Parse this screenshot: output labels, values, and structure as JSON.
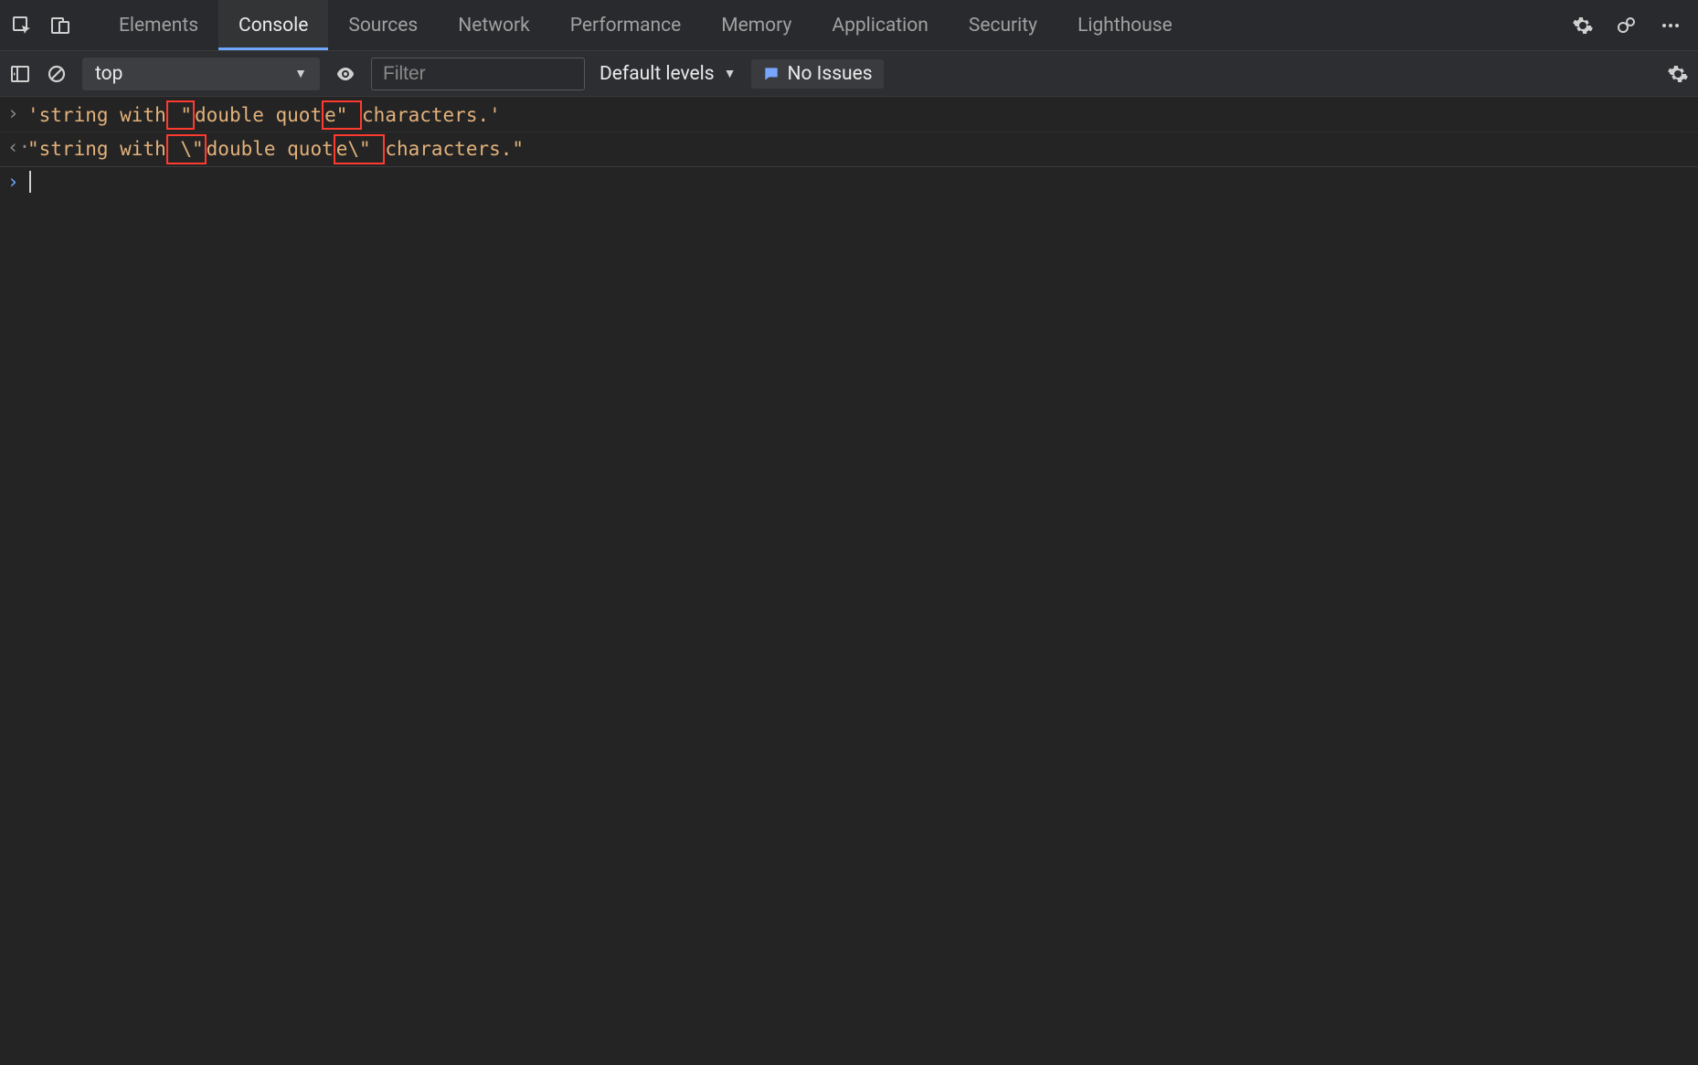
{
  "tabs": {
    "items": [
      {
        "label": "Elements",
        "active": false
      },
      {
        "label": "Console",
        "active": true
      },
      {
        "label": "Sources",
        "active": false
      },
      {
        "label": "Network",
        "active": false
      },
      {
        "label": "Performance",
        "active": false
      },
      {
        "label": "Memory",
        "active": false
      },
      {
        "label": "Application",
        "active": false
      },
      {
        "label": "Security",
        "active": false
      },
      {
        "label": "Lighthouse",
        "active": false
      }
    ]
  },
  "toolbar": {
    "context_label": "top",
    "filter_placeholder": "Filter",
    "levels_label": "Default levels",
    "issues_label": "No Issues"
  },
  "console": {
    "input_line": {
      "pre": "'string with",
      "hl1": " \"",
      "mid": "double quot",
      "hl2": "e\" ",
      "post": "characters.'"
    },
    "output_line": {
      "pre": "\"string with",
      "hl1": " \\\"",
      "mid": "double quot",
      "hl2": "e\\\" ",
      "post": "characters.\""
    }
  }
}
